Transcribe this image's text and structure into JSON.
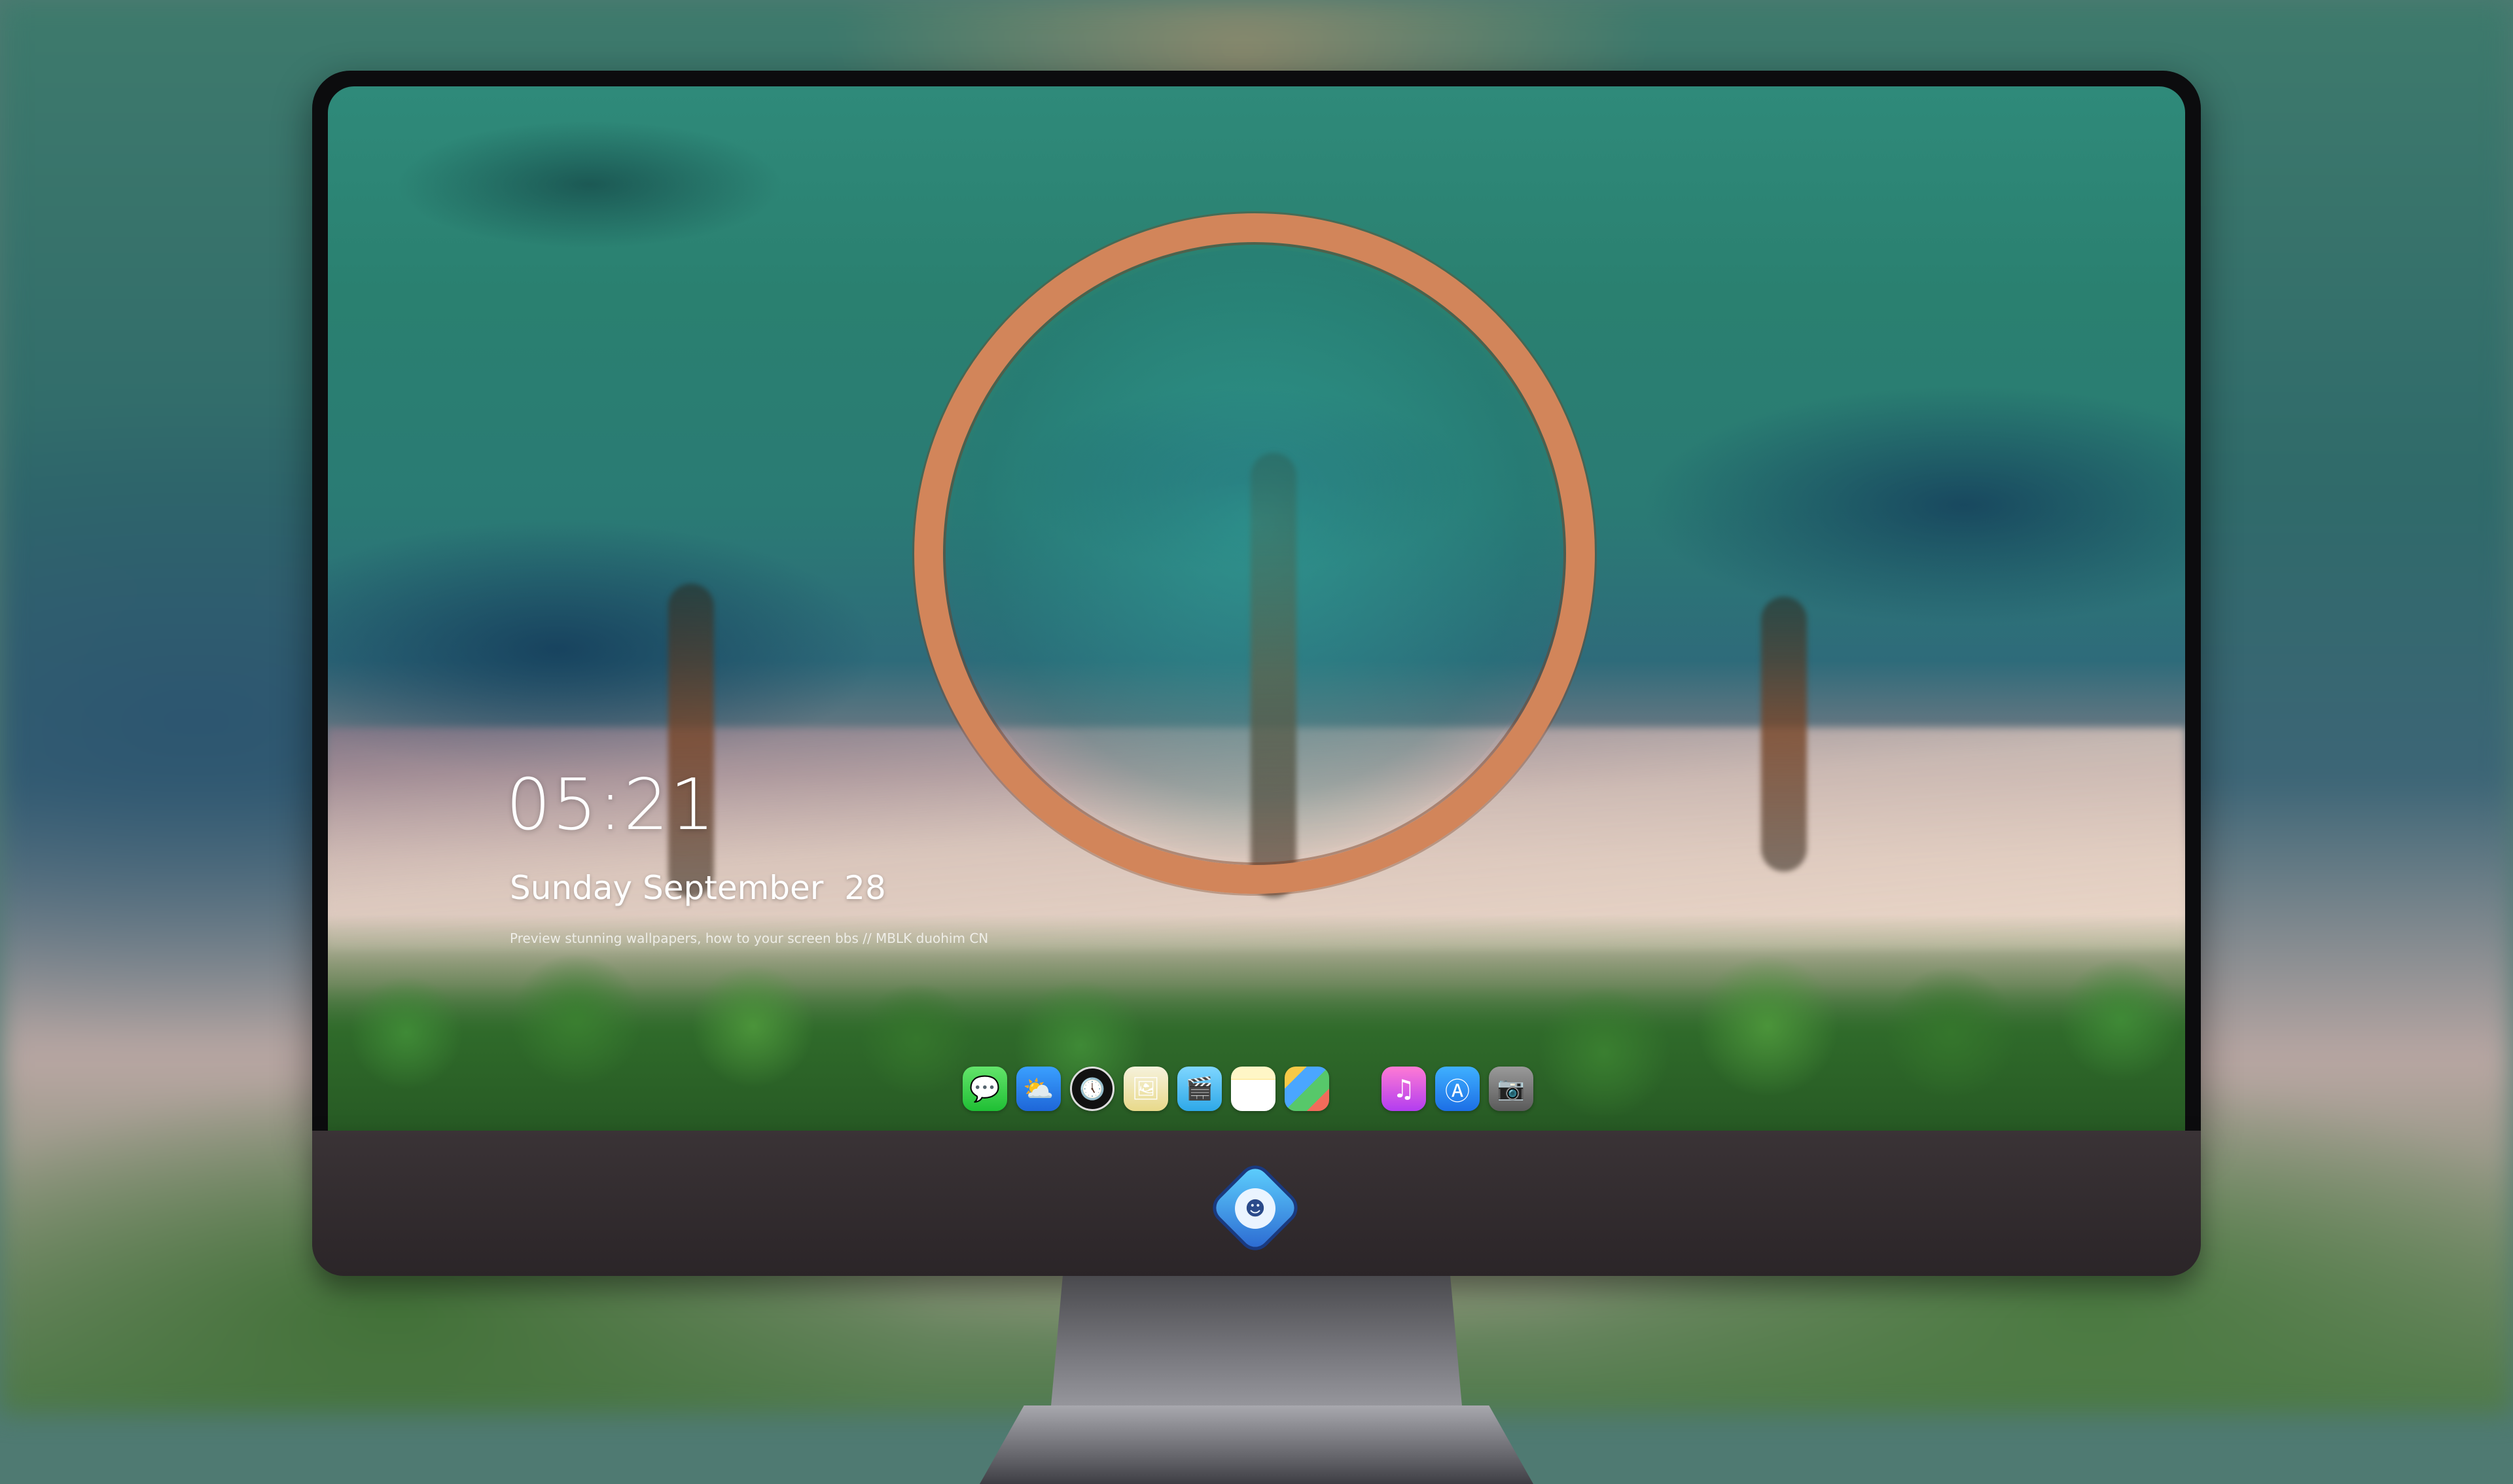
{
  "lockscreen": {
    "time": "05:21",
    "date": "Sunday September  28",
    "tagline": "Preview stunning wallpapers, how to your screen bbs // MBLK duohim CN"
  },
  "dock": {
    "apps": [
      {
        "name": "Messages",
        "icon": "message-bubble-icon",
        "glyph": "💬"
      },
      {
        "name": "Weather",
        "icon": "cloud-sun-icon",
        "glyph": "⛅"
      },
      {
        "name": "Clock",
        "icon": "clock-icon",
        "glyph": "🕔"
      },
      {
        "name": "Preview",
        "icon": "preview-icon",
        "glyph": "🖼"
      },
      {
        "name": "Video",
        "icon": "clapperboard-icon",
        "glyph": "🎬"
      },
      {
        "name": "Notes",
        "icon": "notes-icon",
        "glyph": ""
      },
      {
        "name": "Calculator",
        "icon": "calculator-icon",
        "glyph": ""
      },
      {
        "name": "Music",
        "icon": "music-note-icon",
        "glyph": "♫"
      },
      {
        "name": "App Store",
        "icon": "app-store-icon",
        "glyph": "Ⓐ"
      },
      {
        "name": "Camera",
        "icon": "camera-icon",
        "glyph": "📷"
      }
    ]
  },
  "theme": {
    "bezel": "#0c0c0e",
    "chin": "#332c2f",
    "ring": "#d2855a",
    "logo": "#3a9af0"
  }
}
